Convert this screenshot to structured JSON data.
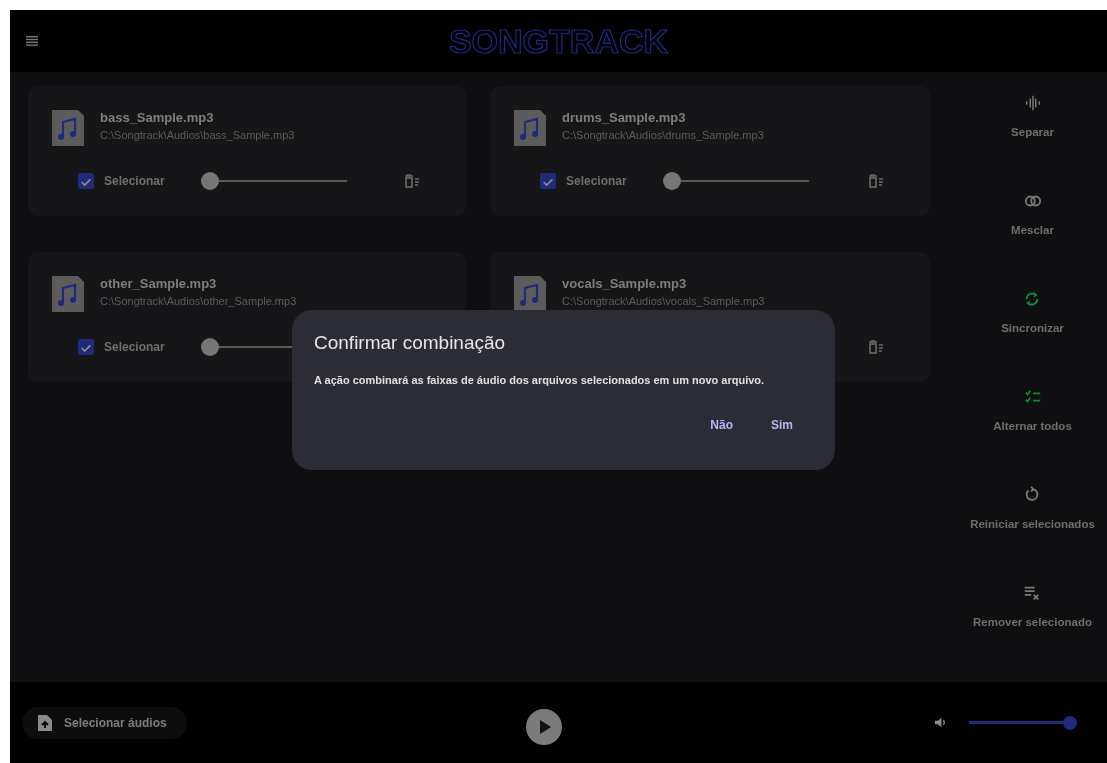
{
  "header": {
    "title": "SONGTRACK"
  },
  "files": [
    {
      "name": "bass_Sample.mp3",
      "path": "C:\\Songtrack\\Audios\\bass_Sample.mp3",
      "select": {
        "label": "Selecionar",
        "checked": true
      },
      "slider": {
        "level": 0
      },
      "show_trash": true
    },
    {
      "name": "drums_Sample.mp3",
      "path": "C:\\Songtrack\\Audios\\drums_Sample.mp3",
      "select": {
        "label": "Selecionar",
        "checked": true
      },
      "slider": {
        "level": 0
      },
      "show_trash": true
    },
    {
      "name": "other_Sample.mp3",
      "path": "C:\\Songtrack\\Audios\\other_Sample.mp3",
      "select": {
        "label": "Selecionar",
        "checked": true
      },
      "slider": {
        "level": 0
      },
      "show_trash": false
    },
    {
      "name": "vocals_Sample.mp3",
      "path": "C:\\Songtrack\\Audios\\vocals_Sample.mp3",
      "show_trash": true
    }
  ],
  "tools": [
    {
      "kind": "separate",
      "label": "Separar",
      "highlighted": false
    },
    {
      "kind": "merge",
      "label": "Mesclar",
      "highlighted": false
    },
    {
      "kind": "sync",
      "label": "Sincronizar",
      "highlighted": true
    },
    {
      "kind": "toggle",
      "label": "Alternar todos",
      "highlighted": true
    },
    {
      "kind": "reset",
      "label": "Reiniciar selecionados",
      "highlighted": false
    },
    {
      "kind": "remove",
      "label": "Remover selecionado",
      "highlighted": false
    }
  ],
  "dialog": {
    "title": "Confirmar combinação",
    "message": "A ação combinará as faixas de áudio dos arquivos selecionados em um novo arquivo.",
    "buttons": [
      "Não",
      "Sim"
    ]
  },
  "footer": {
    "select_button": "Selecionar áudios",
    "volume": {
      "level": 1
    }
  }
}
